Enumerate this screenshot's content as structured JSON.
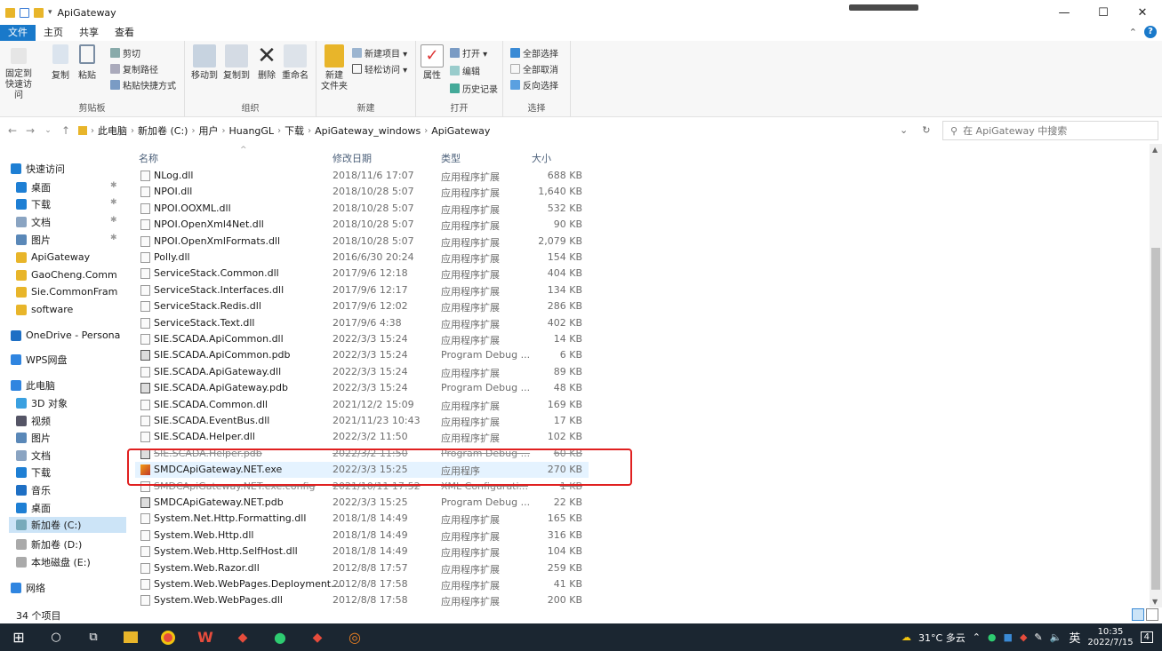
{
  "window": {
    "title": "ApiGateway",
    "min_icon": "minimize-icon",
    "max_icon": "maximize-icon",
    "close_icon": "close-icon",
    "help_label": "?"
  },
  "tabs": [
    "文件",
    "主页",
    "共享",
    "查看"
  ],
  "ribbon": {
    "clipboard": {
      "group": "剪贴板",
      "pin": "固定到\n快速访问",
      "copy": "复制",
      "paste": "粘贴",
      "cut": "剪切",
      "copy_path": "复制路径",
      "paste_shortcut": "粘贴快捷方式"
    },
    "organize": {
      "group": "组织",
      "move": "移动到",
      "copy_to": "复制到",
      "delete": "删除",
      "rename": "重命名"
    },
    "new": {
      "group": "新建",
      "new_folder": "新建\n文件夹",
      "new_item": "新建项目 ▾",
      "easy_access": "轻松访问 ▾"
    },
    "open": {
      "group": "打开",
      "properties": "属性",
      "open": "打开 ▾",
      "edit": "编辑",
      "history": "历史记录"
    },
    "select": {
      "group": "选择",
      "select_all": "全部选择",
      "select_none": "全部取消",
      "invert": "反向选择"
    }
  },
  "address": {
    "crumbs": [
      "此电脑",
      "新加卷 (C:)",
      "用户",
      "HuangGL",
      "下载",
      "ApiGateway_windows",
      "ApiGateway"
    ],
    "search_placeholder": "在 ApiGateway 中搜索"
  },
  "nav": {
    "items": [
      {
        "label": "快速访问",
        "icon": "star-icon",
        "color": "#1e7fd4"
      },
      {
        "label": "桌面",
        "icon": "desktop-icon",
        "color": "#1e7fd4",
        "pin": true
      },
      {
        "label": "下载",
        "icon": "download-icon",
        "color": "#1e7fd4",
        "pin": true
      },
      {
        "label": "文档",
        "icon": "document-icon",
        "color": "#8aa4c2",
        "pin": true
      },
      {
        "label": "图片",
        "icon": "picture-icon",
        "color": "#5a88b8",
        "pin": true
      },
      {
        "label": "ApiGateway",
        "icon": "folder-icon",
        "color": "#e8b52a"
      },
      {
        "label": "GaoCheng.Comm",
        "icon": "folder-icon",
        "color": "#e8b52a"
      },
      {
        "label": "Sie.CommonFram",
        "icon": "folder-icon",
        "color": "#e8b52a"
      },
      {
        "label": "software",
        "icon": "folder-icon",
        "color": "#e8b52a"
      },
      {
        "label": "OneDrive - Persona",
        "icon": "cloud-icon",
        "color": "#1e6fc4"
      },
      {
        "label": "WPS网盘",
        "icon": "cloud-icon",
        "color": "#2f85e0"
      },
      {
        "label": "此电脑",
        "icon": "computer-icon",
        "color": "#2f85e0"
      },
      {
        "label": "3D 对象",
        "icon": "cube-icon",
        "color": "#3aa0e0"
      },
      {
        "label": "视频",
        "icon": "video-icon",
        "color": "#556"
      },
      {
        "label": "图片",
        "icon": "picture-icon",
        "color": "#5a88b8"
      },
      {
        "label": "文档",
        "icon": "document-icon",
        "color": "#8aa4c2"
      },
      {
        "label": "下载",
        "icon": "download-icon",
        "color": "#1e7fd4"
      },
      {
        "label": "音乐",
        "icon": "music-icon",
        "color": "#1e6fc4"
      },
      {
        "label": "桌面",
        "icon": "desktop-icon",
        "color": "#1e7fd4"
      },
      {
        "label": "新加卷 (C:)",
        "icon": "drive-icon",
        "color": "#7ab"
      },
      {
        "label": "新加卷 (D:)",
        "icon": "drive-icon",
        "color": "#aaa"
      },
      {
        "label": "本地磁盘 (E:)",
        "icon": "drive-icon",
        "color": "#aaa"
      },
      {
        "label": "网络",
        "icon": "network-icon",
        "color": "#2f85e0"
      }
    ]
  },
  "columns": {
    "name": "名称",
    "date": "修改日期",
    "type": "类型",
    "size": "大小"
  },
  "files": [
    {
      "name": "NLog.dll",
      "date": "2018/11/6 17:07",
      "type": "应用程序扩展",
      "size": "688 KB",
      "kind": "dll"
    },
    {
      "name": "NPOI.dll",
      "date": "2018/10/28 5:07",
      "type": "应用程序扩展",
      "size": "1,640 KB",
      "kind": "dll"
    },
    {
      "name": "NPOI.OOXML.dll",
      "date": "2018/10/28 5:07",
      "type": "应用程序扩展",
      "size": "532 KB",
      "kind": "dll"
    },
    {
      "name": "NPOI.OpenXml4Net.dll",
      "date": "2018/10/28 5:07",
      "type": "应用程序扩展",
      "size": "90 KB",
      "kind": "dll"
    },
    {
      "name": "NPOI.OpenXmlFormats.dll",
      "date": "2018/10/28 5:07",
      "type": "应用程序扩展",
      "size": "2,079 KB",
      "kind": "dll"
    },
    {
      "name": "Polly.dll",
      "date": "2016/6/30 20:24",
      "type": "应用程序扩展",
      "size": "154 KB",
      "kind": "dll"
    },
    {
      "name": "ServiceStack.Common.dll",
      "date": "2017/9/6 12:18",
      "type": "应用程序扩展",
      "size": "404 KB",
      "kind": "dll"
    },
    {
      "name": "ServiceStack.Interfaces.dll",
      "date": "2017/9/6 12:17",
      "type": "应用程序扩展",
      "size": "134 KB",
      "kind": "dll"
    },
    {
      "name": "ServiceStack.Redis.dll",
      "date": "2017/9/6 12:02",
      "type": "应用程序扩展",
      "size": "286 KB",
      "kind": "dll"
    },
    {
      "name": "ServiceStack.Text.dll",
      "date": "2017/9/6 4:38",
      "type": "应用程序扩展",
      "size": "402 KB",
      "kind": "dll"
    },
    {
      "name": "SIE.SCADA.ApiCommon.dll",
      "date": "2022/3/3 15:24",
      "type": "应用程序扩展",
      "size": "14 KB",
      "kind": "dll"
    },
    {
      "name": "SIE.SCADA.ApiCommon.pdb",
      "date": "2022/3/3 15:24",
      "type": "Program Debug ...",
      "size": "6 KB",
      "kind": "pdb"
    },
    {
      "name": "SIE.SCADA.ApiGateway.dll",
      "date": "2022/3/3 15:24",
      "type": "应用程序扩展",
      "size": "89 KB",
      "kind": "dll"
    },
    {
      "name": "SIE.SCADA.ApiGateway.pdb",
      "date": "2022/3/3 15:24",
      "type": "Program Debug ...",
      "size": "48 KB",
      "kind": "pdb"
    },
    {
      "name": "SIE.SCADA.Common.dll",
      "date": "2021/12/2 15:09",
      "type": "应用程序扩展",
      "size": "169 KB",
      "kind": "dll"
    },
    {
      "name": "SIE.SCADA.EventBus.dll",
      "date": "2021/11/23 10:43",
      "type": "应用程序扩展",
      "size": "17 KB",
      "kind": "dll"
    },
    {
      "name": "SIE.SCADA.Helper.dll",
      "date": "2022/3/2 11:50",
      "type": "应用程序扩展",
      "size": "102 KB",
      "kind": "dll"
    },
    {
      "name": "SIE.SCADA.Helper.pdb",
      "date": "2022/3/2 11:50",
      "type": "Program Debug ...",
      "size": "60 KB",
      "kind": "pdb",
      "strike": true
    },
    {
      "name": "SMDCApiGateway.NET.exe",
      "date": "2022/3/3 15:25",
      "type": "应用程序",
      "size": "270 KB",
      "kind": "exe",
      "hl": true
    },
    {
      "name": "SMDCApiGateway.NET.exe.config",
      "date": "2021/10/11 17:52",
      "type": "XML Configurati...",
      "size": "1 KB",
      "kind": "cfg",
      "strike": true
    },
    {
      "name": "SMDCApiGateway.NET.pdb",
      "date": "2022/3/3 15:25",
      "type": "Program Debug ...",
      "size": "22 KB",
      "kind": "pdb"
    },
    {
      "name": "System.Net.Http.Formatting.dll",
      "date": "2018/1/8 14:49",
      "type": "应用程序扩展",
      "size": "165 KB",
      "kind": "dll"
    },
    {
      "name": "System.Web.Http.dll",
      "date": "2018/1/8 14:49",
      "type": "应用程序扩展",
      "size": "316 KB",
      "kind": "dll"
    },
    {
      "name": "System.Web.Http.SelfHost.dll",
      "date": "2018/1/8 14:49",
      "type": "应用程序扩展",
      "size": "104 KB",
      "kind": "dll"
    },
    {
      "name": "System.Web.Razor.dll",
      "date": "2012/8/8 17:57",
      "type": "应用程序扩展",
      "size": "259 KB",
      "kind": "dll"
    },
    {
      "name": "System.Web.WebPages.Deployment....",
      "date": "2012/8/8 17:58",
      "type": "应用程序扩展",
      "size": "41 KB",
      "kind": "dll"
    },
    {
      "name": "System.Web.WebPages.dll",
      "date": "2012/8/8 17:58",
      "type": "应用程序扩展",
      "size": "200 KB",
      "kind": "dll"
    }
  ],
  "status": {
    "count": "34 个项目"
  },
  "tray": {
    "weather": "31°C 多云",
    "ime": "英",
    "time": "10:35",
    "date": "2022/7/15",
    "notif": "4"
  }
}
